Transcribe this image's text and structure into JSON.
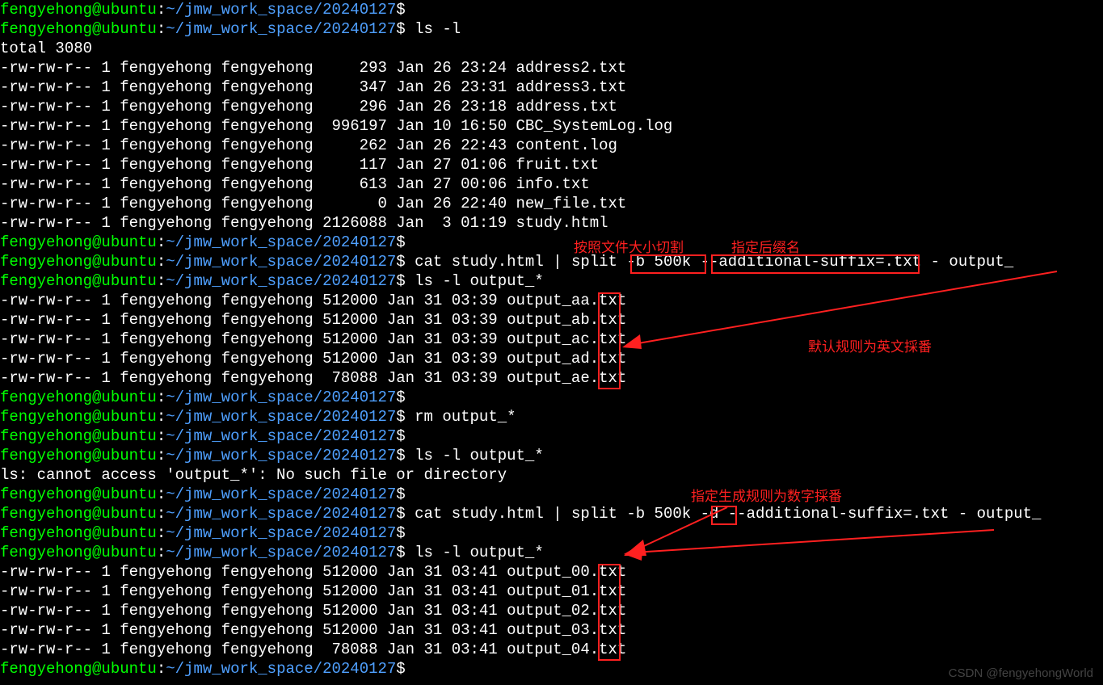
{
  "prompt": {
    "user_host": "fengyehong@ubuntu",
    "colon": ":",
    "path": "~/jmw_work_space/20240127",
    "dollar": "$ "
  },
  "lines": [
    {
      "t": "prompt",
      "cmd": ""
    },
    {
      "t": "prompt",
      "cmd": "ls -l"
    },
    {
      "t": "out",
      "text": "total 3080"
    },
    {
      "t": "out",
      "text": "-rw-rw-r-- 1 fengyehong fengyehong     293 Jan 26 23:24 address2.txt"
    },
    {
      "t": "out",
      "text": "-rw-rw-r-- 1 fengyehong fengyehong     347 Jan 26 23:31 address3.txt"
    },
    {
      "t": "out",
      "text": "-rw-rw-r-- 1 fengyehong fengyehong     296 Jan 26 23:18 address.txt"
    },
    {
      "t": "out",
      "text": "-rw-rw-r-- 1 fengyehong fengyehong  996197 Jan 10 16:50 CBC_SystemLog.log"
    },
    {
      "t": "out",
      "text": "-rw-rw-r-- 1 fengyehong fengyehong     262 Jan 26 22:43 content.log"
    },
    {
      "t": "out",
      "text": "-rw-rw-r-- 1 fengyehong fengyehong     117 Jan 27 01:06 fruit.txt"
    },
    {
      "t": "out",
      "text": "-rw-rw-r-- 1 fengyehong fengyehong     613 Jan 27 00:06 info.txt"
    },
    {
      "t": "out",
      "text": "-rw-rw-r-- 1 fengyehong fengyehong       0 Jan 26 22:40 new_file.txt"
    },
    {
      "t": "out",
      "text": "-rw-rw-r-- 1 fengyehong fengyehong 2126088 Jan  3 01:19 study.html"
    },
    {
      "t": "prompt",
      "cmd": ""
    },
    {
      "t": "prompt",
      "cmd": "cat study.html | split -b 500k --additional-suffix=.txt - output_"
    },
    {
      "t": "prompt",
      "cmd": "ls -l output_*"
    },
    {
      "t": "out",
      "text": "-rw-rw-r-- 1 fengyehong fengyehong 512000 Jan 31 03:39 output_aa.txt"
    },
    {
      "t": "out",
      "text": "-rw-rw-r-- 1 fengyehong fengyehong 512000 Jan 31 03:39 output_ab.txt"
    },
    {
      "t": "out",
      "text": "-rw-rw-r-- 1 fengyehong fengyehong 512000 Jan 31 03:39 output_ac.txt"
    },
    {
      "t": "out",
      "text": "-rw-rw-r-- 1 fengyehong fengyehong 512000 Jan 31 03:39 output_ad.txt"
    },
    {
      "t": "out",
      "text": "-rw-rw-r-- 1 fengyehong fengyehong  78088 Jan 31 03:39 output_ae.txt"
    },
    {
      "t": "prompt",
      "cmd": ""
    },
    {
      "t": "prompt",
      "cmd": "rm output_*"
    },
    {
      "t": "prompt",
      "cmd": ""
    },
    {
      "t": "prompt",
      "cmd": "ls -l output_*"
    },
    {
      "t": "out",
      "text": "ls: cannot access 'output_*': No such file or directory"
    },
    {
      "t": "prompt",
      "cmd": ""
    },
    {
      "t": "prompt",
      "cmd": "cat study.html | split -b 500k -d --additional-suffix=.txt - output_"
    },
    {
      "t": "prompt",
      "cmd": ""
    },
    {
      "t": "prompt",
      "cmd": "ls -l output_*"
    },
    {
      "t": "out",
      "text": "-rw-rw-r-- 1 fengyehong fengyehong 512000 Jan 31 03:41 output_00.txt"
    },
    {
      "t": "out",
      "text": "-rw-rw-r-- 1 fengyehong fengyehong 512000 Jan 31 03:41 output_01.txt"
    },
    {
      "t": "out",
      "text": "-rw-rw-r-- 1 fengyehong fengyehong 512000 Jan 31 03:41 output_02.txt"
    },
    {
      "t": "out",
      "text": "-rw-rw-r-- 1 fengyehong fengyehong 512000 Jan 31 03:41 output_03.txt"
    },
    {
      "t": "out",
      "text": "-rw-rw-r-- 1 fengyehong fengyehong  78088 Jan 31 03:41 output_04.txt"
    },
    {
      "t": "prompt",
      "cmd": ""
    }
  ],
  "annotations": {
    "split_by_size": "按照文件大小切割",
    "specify_suffix": "指定后缀名",
    "default_english": "默认规则为英文採番",
    "numeric_rule": "指定生成规则为数字採番"
  },
  "watermark": "CSDN @fengyehongWorld"
}
